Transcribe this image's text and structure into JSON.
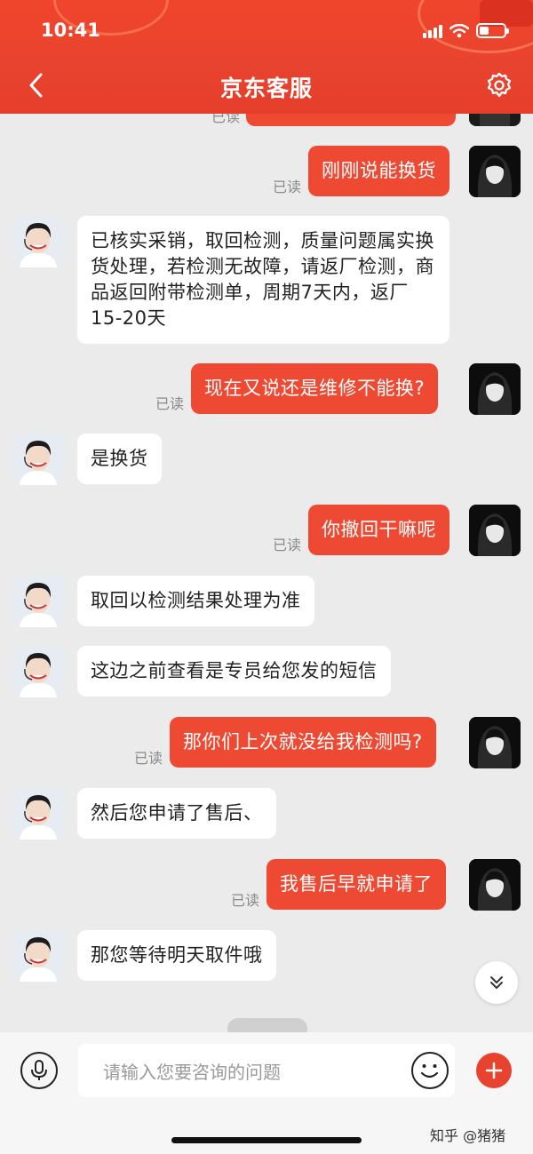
{
  "status_bar": {
    "time": "10:41"
  },
  "header": {
    "title": "京东客服"
  },
  "read_label": "已读",
  "messages": [
    {
      "from": "user",
      "text": "刚刚说能换货"
    },
    {
      "from": "agent",
      "text": "已核实采销，取回检测，质量问题属实换货处理，若检测无故障，请返厂检测，商品返回附带检测单，周期7天内，返厂 15-20天"
    },
    {
      "from": "user",
      "text": "现在又说还是维修不能换?"
    },
    {
      "from": "agent",
      "text": "是换货"
    },
    {
      "from": "user",
      "text": "你撤回干嘛呢"
    },
    {
      "from": "agent",
      "text": "取回以检测结果处理为准"
    },
    {
      "from": "agent",
      "text": "这边之前查看是专员给您发的短信"
    },
    {
      "from": "user",
      "text": "那你们上次就没给我检测吗?"
    },
    {
      "from": "agent",
      "text": "然后您申请了售后、"
    },
    {
      "from": "user",
      "text": "我售后早就申请了"
    },
    {
      "from": "agent",
      "text": "那您等待明天取件哦"
    }
  ],
  "input": {
    "placeholder": "请输入您要咨询的问题"
  },
  "watermark": "知乎 @猪猪",
  "colors": {
    "accent": "#e8432e",
    "user_bubble": "#ee4a33",
    "background": "#ebebeb"
  }
}
